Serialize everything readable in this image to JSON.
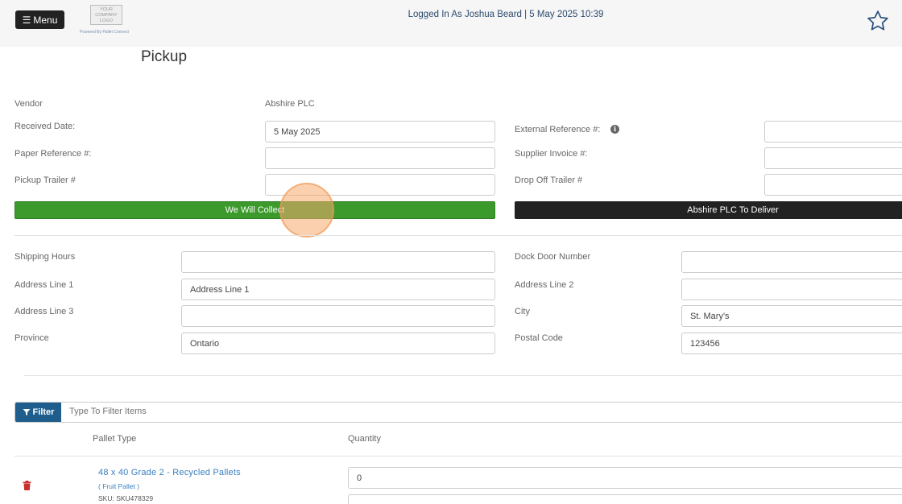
{
  "header": {
    "menu_label": "Menu",
    "logo_lines": [
      "YOUR",
      "COMPANY",
      "LOGO"
    ],
    "powered_by": "Powered By Pallet Connect",
    "logged_in": "Logged In As Joshua Beard | 5 May 2025 10:39"
  },
  "page": {
    "title": "Pickup"
  },
  "form": {
    "vendor_label": "Vendor",
    "vendor_value": "Abshire PLC",
    "received_date_label": "Received Date:",
    "received_date_value": "5 May 2025",
    "external_ref_label": "External Reference #:",
    "external_ref_value": "",
    "paper_ref_label": "Paper Reference #:",
    "paper_ref_value": "",
    "supplier_invoice_label": "Supplier Invoice #:",
    "supplier_invoice_value": "",
    "pickup_trailer_label": "Pickup Trailer #",
    "pickup_trailer_value": "",
    "dropoff_trailer_label": "Drop Off Trailer #",
    "dropoff_trailer_value": ""
  },
  "actions": {
    "we_will_collect": "We Will Collect",
    "vendor_deliver": "Abshire PLC To Deliver"
  },
  "address": {
    "shipping_hours_label": "Shipping Hours",
    "shipping_hours_value": "",
    "dock_door_label": "Dock Door Number",
    "dock_door_value": "",
    "line1_label": "Address Line 1",
    "line1_value": "Address Line 1",
    "line2_label": "Address Line 2",
    "line2_value": "",
    "line3_label": "Address Line 3",
    "line3_value": "",
    "city_label": "City",
    "city_value": "St. Mary's",
    "province_label": "Province",
    "province_value": "Ontario",
    "postal_label": "Postal Code",
    "postal_value": "123456"
  },
  "filter": {
    "button_label": "Filter",
    "placeholder": "Type To Filter Items"
  },
  "items": {
    "col_pallet_type": "Pallet Type",
    "col_quantity": "Quantity",
    "rows": [
      {
        "name": "48 x 40 Grade 2 - Recycled Pallets",
        "category": "( Fruit Pallet )",
        "sku": "SKU: SKU478329",
        "quantity": "0"
      }
    ]
  },
  "colors": {
    "green": "#3c9a2d",
    "dark": "#222222",
    "filter_blue": "#1f5e8c",
    "link": "#3a7fc1",
    "trash": "#c9302c"
  }
}
